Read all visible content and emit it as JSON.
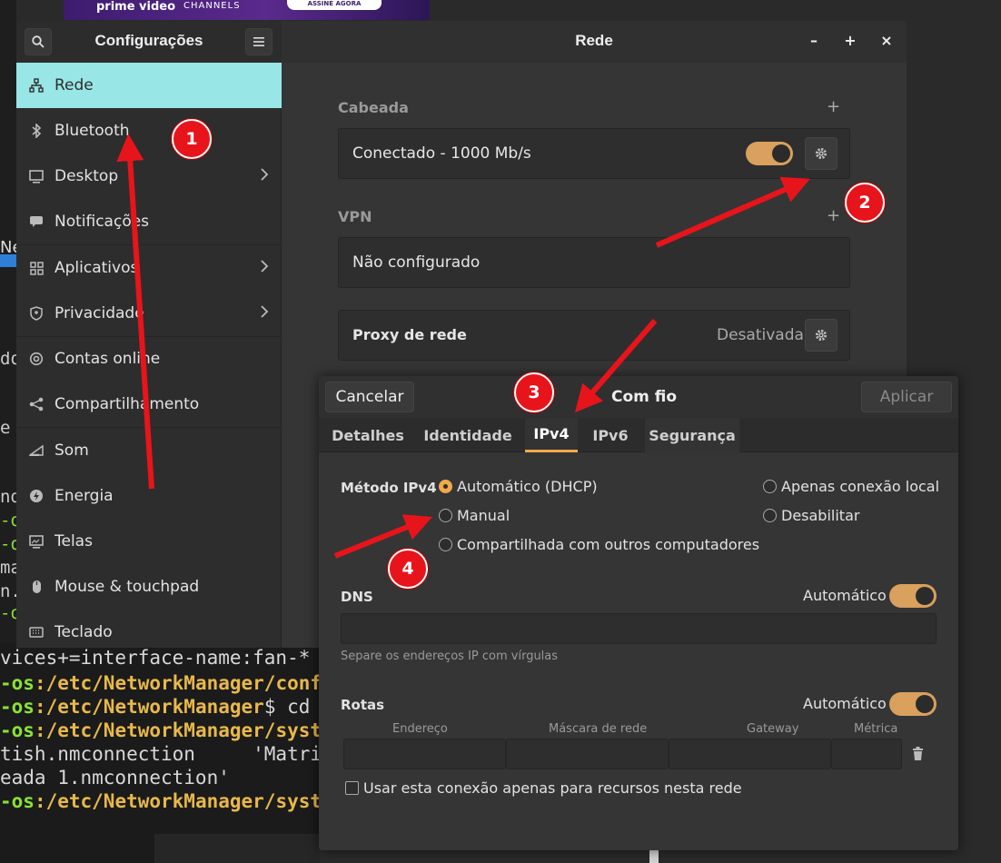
{
  "background": {
    "banner": {
      "brand": "prime video",
      "channels": "CHANNELS",
      "cta": "ASSINE AGORA"
    },
    "left_fragment": "Ne",
    "left_edge_fragments": [
      "do",
      "e",
      "nd",
      "-o",
      "-o",
      "ma",
      "n.",
      "-o"
    ],
    "terminal_lines": [
      {
        "prompt": "",
        "path": "",
        "rest": "vices+=interface-name:fan-*"
      },
      {
        "prompt": "-os",
        "path": ":/etc/NetworkManager/conf",
        "rest": ""
      },
      {
        "prompt": "-os",
        "path": ":/etc/NetworkManager",
        "rest": "$ cd"
      },
      {
        "prompt": "-os",
        "path": ":/etc/NetworkManager/syst",
        "rest": ""
      },
      {
        "prompt": "",
        "path": "",
        "rest": "tish.nmconnection     'Matri"
      },
      {
        "prompt": "",
        "path": "",
        "rest": "eada 1.nmconnection'"
      },
      {
        "prompt": "-os",
        "path": ":/etc/NetworkManager/syst",
        "rest": ""
      }
    ]
  },
  "settings": {
    "sidebar_title": "Configurações",
    "content_title": "Rede",
    "window_controls": {
      "minimize": "–",
      "maximize": "+",
      "close": "×"
    },
    "sidebar_items": [
      {
        "label": "Rede",
        "icon": "network-icon",
        "active": true
      },
      {
        "label": "Bluetooth",
        "icon": "bluetooth-icon"
      },
      {
        "label": "Desktop",
        "icon": "desktop-icon",
        "chevron": true
      },
      {
        "label": "Notificações",
        "icon": "notifications-icon"
      },
      {
        "label": "Aplicativos",
        "icon": "apps-icon",
        "chevron": true
      },
      {
        "label": "Privacidade",
        "icon": "privacy-icon",
        "chevron": true
      },
      {
        "label": "Contas online",
        "icon": "at-icon"
      },
      {
        "label": "Compartilhamento",
        "icon": "share-icon"
      },
      {
        "label": "Som",
        "icon": "sound-icon"
      },
      {
        "label": "Energia",
        "icon": "power-icon"
      },
      {
        "label": "Telas",
        "icon": "displays-icon"
      },
      {
        "label": "Mouse & touchpad",
        "icon": "mouse-icon"
      },
      {
        "label": "Teclado",
        "icon": "keyboard-icon"
      }
    ],
    "wired": {
      "label": "Cabeada",
      "add": "+",
      "status": "Conectado - 1000 Mb/s",
      "enabled": true
    },
    "vpn": {
      "label": "VPN",
      "add": "+",
      "status": "Não configurado"
    },
    "proxy": {
      "label": "Proxy de rede",
      "status": "Desativada"
    }
  },
  "dialog": {
    "title": "Com fio",
    "cancel": "Cancelar",
    "apply": "Aplicar",
    "tabs": [
      "Detalhes",
      "Identidade",
      "IPv4",
      "IPv6",
      "Segurança"
    ],
    "active_tab": "IPv4",
    "ipv4": {
      "method_label": "Método IPv4",
      "methods": [
        {
          "label": "Automático (DHCP)",
          "selected": true
        },
        {
          "label": "Manual",
          "selected": false
        },
        {
          "label": "Compartilhada com outros computadores",
          "selected": false
        },
        {
          "label": "Apenas conexão local",
          "selected": false
        },
        {
          "label": "Desabilitar",
          "selected": false
        }
      ],
      "dns": {
        "label": "DNS",
        "auto_label": "Automático",
        "auto": true,
        "value": "",
        "hint": "Separe os endereços IP com vírgulas"
      },
      "routes": {
        "label": "Rotas",
        "auto_label": "Automático",
        "auto": true,
        "columns": [
          "Endereço",
          "Máscara de rede",
          "Gateway",
          "Métrica"
        ]
      },
      "only_local_resources": {
        "label": "Usar esta conexão apenas para recursos nesta rede",
        "checked": false
      }
    }
  },
  "annotations": {
    "badges": [
      "1",
      "2",
      "3",
      "4"
    ],
    "arrow_color": "#e8141b"
  },
  "colors": {
    "accent": "#f2a94a",
    "active_sidebar": "#99e6e6",
    "toggle_on": "#d9a05e"
  }
}
